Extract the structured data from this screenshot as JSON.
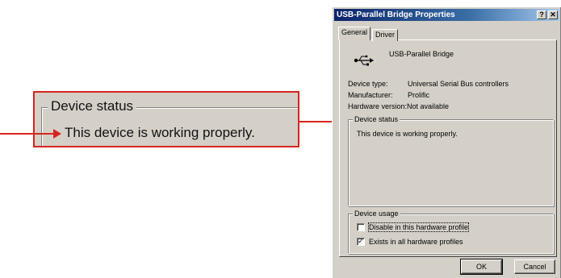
{
  "callout": {
    "legend": "Device status",
    "status": "This device is working properly."
  },
  "dialog": {
    "title": "USB-Parallel Bridge Properties",
    "help_button": "?",
    "close_button": "✕",
    "tabs": [
      {
        "label": "General",
        "active": true
      },
      {
        "label": "Driver",
        "active": false
      }
    ],
    "device_name": "USB-Parallel Bridge",
    "device_icon": "usb-icon",
    "properties": [
      {
        "label": "Device type:",
        "value": "Universal Serial Bus controllers"
      },
      {
        "label": "Manufacturer:",
        "value": "Prolific"
      },
      {
        "label": "Hardware version:",
        "value": "Not available"
      }
    ],
    "status_group": {
      "legend": "Device status",
      "text": "This device is working properly."
    },
    "usage_group": {
      "legend": "Device usage",
      "options": [
        {
          "label": "Disable in this hardware profile",
          "checked": false
        },
        {
          "label": "Exists in all hardware profiles",
          "checked": true
        }
      ]
    },
    "buttons": {
      "ok": "OK",
      "cancel": "Cancel"
    }
  },
  "colors": {
    "callout_border": "#d6251f",
    "arrow": "#d6251f",
    "dialog_face": "#d4d0c8",
    "titlebar_start": "#0a246a",
    "titlebar_end": "#a6caf0"
  }
}
